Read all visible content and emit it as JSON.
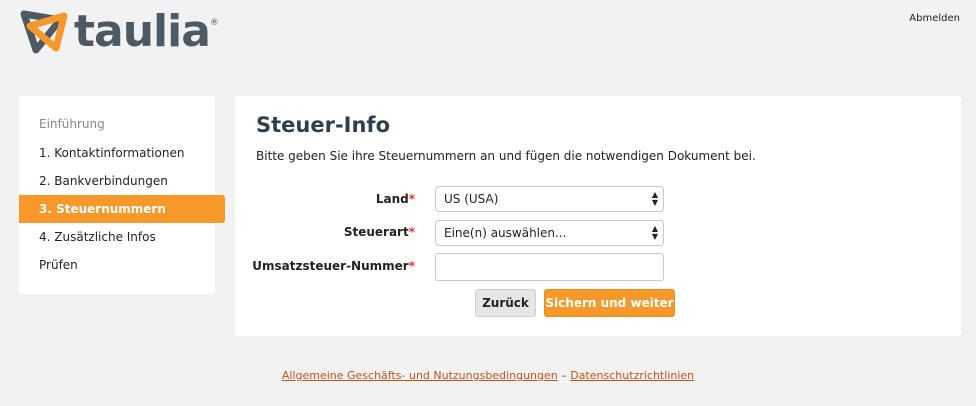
{
  "header": {
    "logo_text": "taulia",
    "logo_mark": "®",
    "signout_label": "Abmelden"
  },
  "sidebar": {
    "heading": "Einführung",
    "items": [
      {
        "label": "1. Kontaktinformationen",
        "active": false
      },
      {
        "label": "2. Bankverbindungen",
        "active": false
      },
      {
        "label": "3. Steuernummern",
        "active": true
      },
      {
        "label": "4. Zusätzliche Infos",
        "active": false
      },
      {
        "label": "Prüfen",
        "active": false
      }
    ]
  },
  "main": {
    "title": "Steuer-Info",
    "description": "Bitte geben Sie ihre Steuernummern an und fügen die notwendigen Dokument bei.",
    "required_marker": "*",
    "fields": {
      "country": {
        "label": "Land",
        "value": "US (USA)"
      },
      "tax_type": {
        "label": "Steuerart",
        "value": "Eine(n) auswählen..."
      },
      "vat_number": {
        "label": "Umsatzsteuer-Nummer",
        "value": "",
        "placeholder": ""
      }
    },
    "buttons": {
      "back": "Zurück",
      "save_next": "Sichern und weiter"
    }
  },
  "footer": {
    "terms_link": "Allgemeine Geschäfts- und Nutzungsbedingungen",
    "separator": "–",
    "privacy_link": "Datenschutzrichtlinien"
  },
  "colors": {
    "accent": "#f7982a",
    "title": "#2f3f4d",
    "link": "#c2531b",
    "background": "#f2f2f2"
  }
}
